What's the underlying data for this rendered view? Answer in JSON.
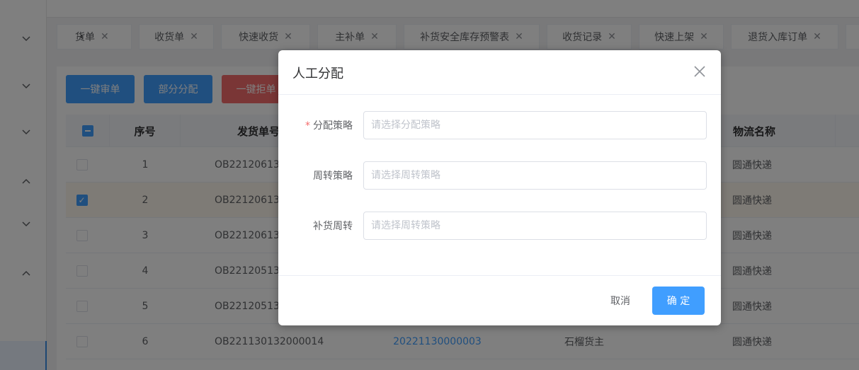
{
  "colors": {
    "primary": "#409eff",
    "danger": "#f56c6c",
    "highlight_row": "#fdf6ec"
  },
  "sidebar": {
    "chevrons": [
      "chevron-down-icon",
      "chevron-down-icon",
      "chevron-down-icon",
      "chevron-up-icon",
      "chevron-down-icon",
      "chevron-up-icon"
    ]
  },
  "tabs": [
    {
      "label": "退货单"
    },
    {
      "label": "收货单"
    },
    {
      "label": "快速收货"
    },
    {
      "label": "主补单"
    },
    {
      "label": "补货安全库存预警表"
    },
    {
      "label": "收货记录"
    },
    {
      "label": "快速上架"
    },
    {
      "label": "退货入库订单"
    }
  ],
  "toolbar": {
    "approve_label": "一键审单",
    "partial_label": "部分分配",
    "reject_label": "一键拒单"
  },
  "table": {
    "headers": {
      "index": "序号",
      "order_no": "发货单号",
      "logistics": "物流名称"
    },
    "rows": [
      {
        "index": "1",
        "order_no": "OB22120613",
        "ref": "",
        "owner": "",
        "logistics": "圆通快递",
        "checked": false
      },
      {
        "index": "2",
        "order_no": "OB22120613",
        "ref": "",
        "owner": "",
        "logistics": "圆通快递",
        "checked": true
      },
      {
        "index": "3",
        "order_no": "OB22120613",
        "ref": "",
        "owner": "",
        "logistics": "圆通快递",
        "checked": false
      },
      {
        "index": "4",
        "order_no": "OB22120513",
        "ref": "",
        "owner": "",
        "logistics": "圆通快递",
        "checked": false
      },
      {
        "index": "5",
        "order_no": "OB22120513",
        "ref": "",
        "owner": "",
        "logistics": "圆通快递",
        "checked": false
      },
      {
        "index": "6",
        "order_no": "OB221130132000014",
        "ref": "20221130000003",
        "owner": "石榴货主",
        "logistics": "圆通快递",
        "checked": false
      }
    ]
  },
  "dialog": {
    "title": "人工分配",
    "fields": {
      "strategy": {
        "label": "分配策略",
        "placeholder": "请选择分配策略",
        "required": true
      },
      "turnover": {
        "label": "周转策略",
        "placeholder": "请选择周转策略"
      },
      "replenish": {
        "label": "补货周转",
        "placeholder": "请选择周转策略"
      }
    },
    "cancel_label": "取消",
    "ok_label": "确 定"
  }
}
